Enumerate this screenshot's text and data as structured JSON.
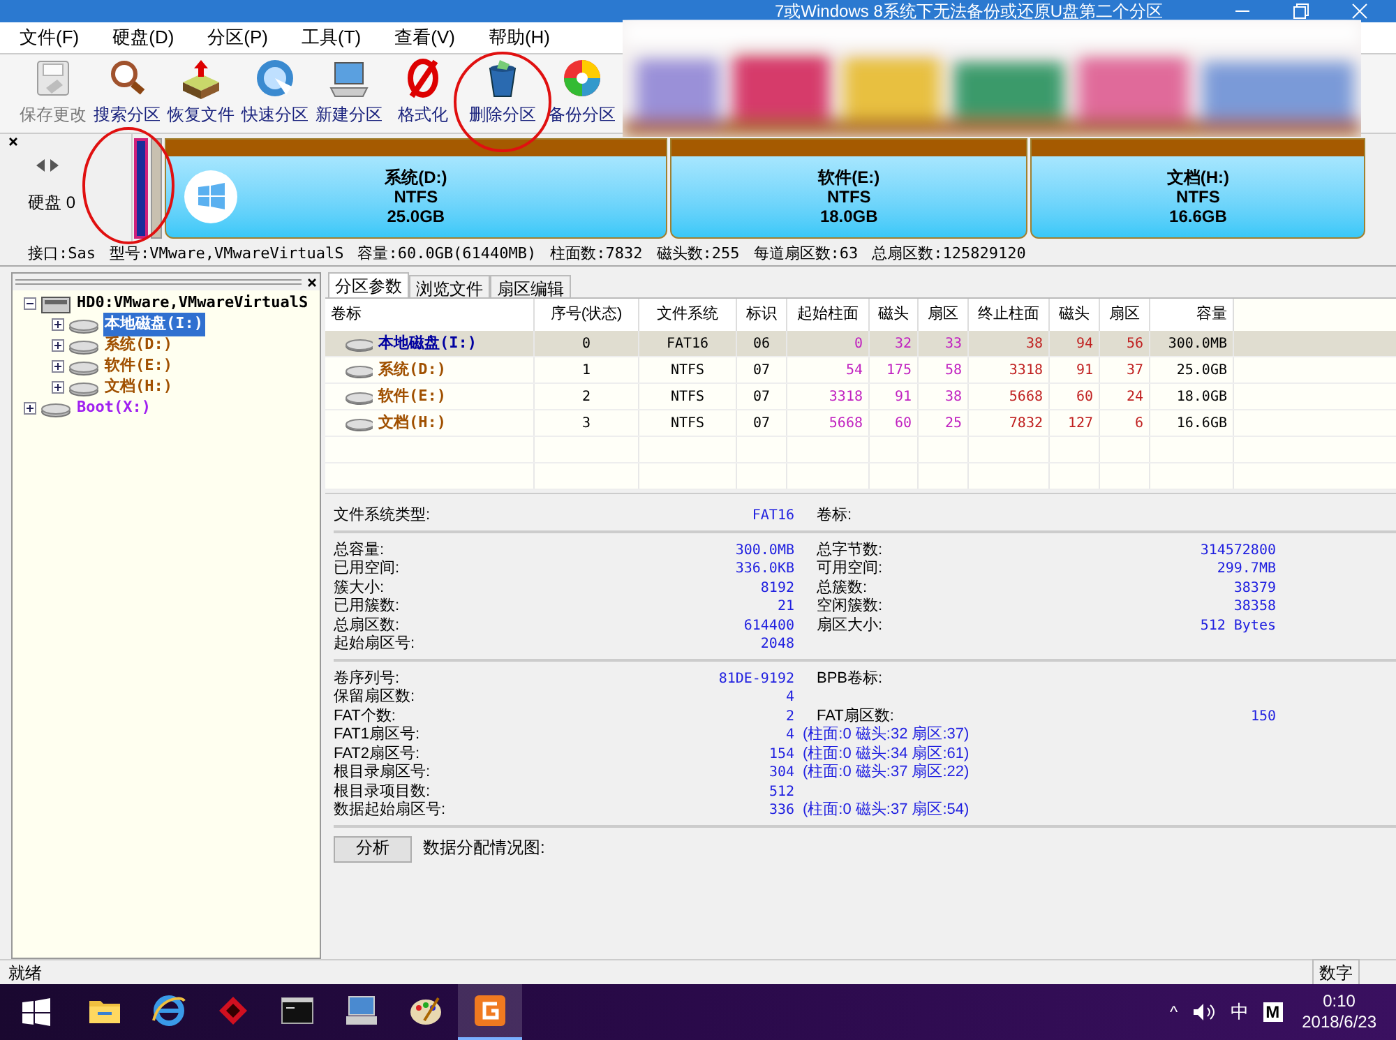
{
  "window": {
    "title": "7或Windows 8系统下无法备份或还原U盘第二个分区"
  },
  "menu": [
    "文件(F)",
    "硬盘(D)",
    "分区(P)",
    "工具(T)",
    "查看(V)",
    "帮助(H)"
  ],
  "toolbar": [
    {
      "label": "保存更改",
      "kind": "save",
      "disabled": true
    },
    {
      "label": "搜索分区",
      "kind": "search",
      "disabled": false
    },
    {
      "label": "恢复文件",
      "kind": "restore",
      "disabled": false
    },
    {
      "label": "快速分区",
      "kind": "quick",
      "disabled": false
    },
    {
      "label": "新建分区",
      "kind": "new",
      "disabled": false
    },
    {
      "label": "格式化",
      "kind": "format",
      "disabled": false
    },
    {
      "label": "删除分区",
      "kind": "delete",
      "disabled": false
    },
    {
      "label": "备份分区",
      "kind": "backup",
      "disabled": false
    }
  ],
  "disk_nav": {
    "label": "硬盘 0"
  },
  "disk_map": [
    {
      "name": "系统(D:)",
      "fs": "NTFS",
      "size": "25.0GB"
    },
    {
      "name": "软件(E:)",
      "fs": "NTFS",
      "size": "18.0GB"
    },
    {
      "name": "文档(H:)",
      "fs": "NTFS",
      "size": "16.6GB"
    }
  ],
  "disk_info": [
    "接口:Sas",
    "型号:VMware,VMwareVirtualS",
    "容量:60.0GB(61440MB)",
    "柱面数:7832",
    "磁头数:255",
    "每道扇区数:63",
    "总扇区数:125829120"
  ],
  "tree": [
    {
      "label": "HD0:VMware,VMwareVirtualS",
      "kind": "disk",
      "expanded": true,
      "selected": false,
      "color": "#000000",
      "children": [
        {
          "label": "本地磁盘(I:)",
          "kind": "partition",
          "expanded": false,
          "selected": true
        },
        {
          "label": "系统(D:)",
          "kind": "partition",
          "expanded": false,
          "selected": false,
          "color": "#a05000"
        },
        {
          "label": "软件(E:)",
          "kind": "partition",
          "expanded": false,
          "selected": false,
          "color": "#a05000"
        },
        {
          "label": "文档(H:)",
          "kind": "partition",
          "expanded": false,
          "selected": false,
          "color": "#a05000"
        }
      ]
    },
    {
      "label": "Boot(X:)",
      "kind": "partition",
      "expanded": false,
      "selected": false,
      "color": "#a020f0"
    }
  ],
  "tabs": [
    {
      "label": "分区参数",
      "selected": true
    },
    {
      "label": "浏览文件",
      "selected": false
    },
    {
      "label": "扇区编辑",
      "selected": false
    }
  ],
  "table": {
    "columns": [
      "卷标",
      "序号(状态)",
      "文件系统",
      "标识",
      "起始柱面",
      "磁头",
      "扇区",
      "终止柱面",
      "磁头",
      "扇区",
      "容量"
    ],
    "rows": [
      {
        "selected": true,
        "color": "#0000a0",
        "cells": [
          "本地磁盘(I:)",
          "0",
          "FAT16",
          "06",
          "0",
          "32",
          "33",
          "38",
          "94",
          "56",
          "300.0MB"
        ]
      },
      {
        "selected": false,
        "color": "#a05000",
        "cells": [
          "系统(D:)",
          "1",
          "NTFS",
          "07",
          "54",
          "175",
          "58",
          "3318",
          "91",
          "37",
          "25.0GB"
        ]
      },
      {
        "selected": false,
        "color": "#a05000",
        "cells": [
          "软件(E:)",
          "2",
          "NTFS",
          "07",
          "3318",
          "91",
          "38",
          "5668",
          "60",
          "24",
          "18.0GB"
        ]
      },
      {
        "selected": false,
        "color": "#a05000",
        "cells": [
          "文档(H:)",
          "3",
          "NTFS",
          "07",
          "5668",
          "60",
          "25",
          "7832",
          "127",
          "6",
          "16.6GB"
        ]
      }
    ]
  },
  "details": [
    [
      {
        "label": "文件系统类型:",
        "value": "FAT16",
        "right_label": "卷标:"
      }
    ],
    [
      {
        "label": "总容量:",
        "value": "300.0MB",
        "right_label": "总字节数:",
        "right_value": "314572800"
      },
      {
        "label": "已用空间:",
        "value": "336.0KB",
        "right_label": "可用空间:",
        "right_value": "299.7MB"
      },
      {
        "label": "簇大小:",
        "value": "8192",
        "right_label": "总簇数:",
        "right_value": "38379"
      },
      {
        "label": "已用簇数:",
        "value": "21",
        "right_label": "空闲簇数:",
        "right_value": "38358"
      },
      {
        "label": "总扇区数:",
        "value": "614400",
        "right_label": "扇区大小:",
        "right_value": "512 Bytes"
      },
      {
        "label": "起始扇区号:",
        "value": "2048"
      }
    ],
    [
      {
        "label": "卷序列号:",
        "value": "81DE-9192",
        "right_label": "BPB卷标:"
      },
      {
        "label": "保留扇区数:",
        "value": "4"
      },
      {
        "label": "FAT个数:",
        "value": "2",
        "right_label": "FAT扇区数:",
        "right_value": "150"
      },
      {
        "label": "FAT1扇区号:",
        "value": "4",
        "extra": "(柱面:0 磁头:32 扇区:37)"
      },
      {
        "label": "FAT2扇区号:",
        "value": "154",
        "extra": "(柱面:0 磁头:34 扇区:61)"
      },
      {
        "label": "根目录扇区号:",
        "value": "304",
        "extra": "(柱面:0 磁头:37 扇区:22)"
      },
      {
        "label": "根目录项目数:",
        "value": "512"
      },
      {
        "label": "数据起始扇区号:",
        "value": "336",
        "extra": "(柱面:0 磁头:37 扇区:54)"
      }
    ]
  ],
  "analyze": {
    "button": "分析",
    "label": "数据分配情况图:"
  },
  "status_bar": {
    "text": "就绪",
    "indicator": "数字"
  },
  "taskbar": {
    "apps": [
      {
        "kind": "folder",
        "active": false
      },
      {
        "kind": "ie",
        "active": false
      },
      {
        "kind": "diamond",
        "active": false
      },
      {
        "kind": "cmd",
        "active": false
      },
      {
        "kind": "computer",
        "active": false
      },
      {
        "kind": "paint",
        "active": false
      },
      {
        "kind": "diskgenius",
        "active": true
      }
    ],
    "tray": {
      "chevron": "^",
      "ime": "中",
      "ime_mode": "M",
      "time": "0:10",
      "date": "2018/6/23"
    }
  }
}
